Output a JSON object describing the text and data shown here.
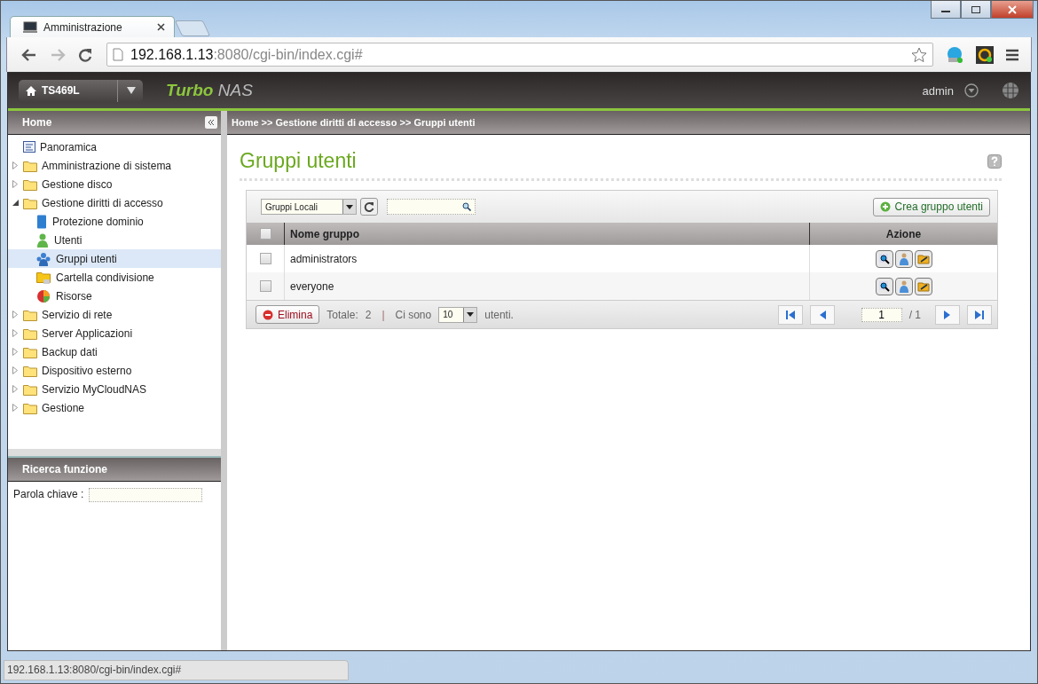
{
  "browser": {
    "tab_title": "Amministrazione",
    "address_host": "192.168.1.13",
    "address_rest": ":8080/cgi-bin/index.cgi#",
    "status_url": "192.168.1.13:8080/cgi-bin/index.cgi#"
  },
  "header": {
    "device": "TS469L",
    "brand_first": "Turbo",
    "brand_second": "NAS",
    "user": "admin"
  },
  "sidebar": {
    "title": "Home",
    "items": [
      {
        "label": "Panoramica",
        "kind": "overview",
        "selected": false
      },
      {
        "label": "Amministrazione di sistema",
        "kind": "folder",
        "expanded": false,
        "selected": false
      },
      {
        "label": "Gestione disco",
        "kind": "folder",
        "expanded": false,
        "selected": false
      },
      {
        "label": "Gestione diritti di accesso",
        "kind": "folder",
        "expanded": true,
        "selected": false,
        "children": [
          {
            "label": "Protezione dominio",
            "kind": "book",
            "selected": false
          },
          {
            "label": "Utenti",
            "kind": "user",
            "selected": false
          },
          {
            "label": "Gruppi utenti",
            "kind": "group",
            "selected": true
          },
          {
            "label": "Cartella condivisione",
            "kind": "share",
            "selected": false
          },
          {
            "label": "Risorse",
            "kind": "resources",
            "selected": false
          }
        ]
      },
      {
        "label": "Servizio di rete",
        "kind": "folder",
        "expanded": false,
        "selected": false
      },
      {
        "label": "Server Applicazioni",
        "kind": "folder",
        "expanded": false,
        "selected": false
      },
      {
        "label": "Backup dati",
        "kind": "folder",
        "expanded": false,
        "selected": false
      },
      {
        "label": "Dispositivo esterno",
        "kind": "folder",
        "expanded": false,
        "selected": false
      },
      {
        "label": "Servizio MyCloudNAS",
        "kind": "folder",
        "expanded": false,
        "selected": false
      },
      {
        "label": "Gestione",
        "kind": "folder",
        "expanded": false,
        "selected": false
      }
    ]
  },
  "search_panel": {
    "title": "Ricerca funzione",
    "label": "Parola chiave :"
  },
  "breadcrumb": "Home >> Gestione diritti di accesso >> Gruppi utenti",
  "page": {
    "title": "Gruppi utenti",
    "filter": "Gruppi Locali",
    "create_button": "Crea gruppo utenti",
    "table": {
      "columns": [
        "Nome gruppo",
        "Azione"
      ],
      "all_checked": false,
      "rows": [
        {
          "name": "administrators",
          "checked": false
        },
        {
          "name": "everyone",
          "checked": false
        }
      ]
    },
    "footer": {
      "delete_button": "Elimina",
      "total_label": "Totale:",
      "total": "2",
      "separator": "|",
      "per_page_label": "Ci sono",
      "per_page": "10",
      "per_page_unit": "utenti.",
      "page": "1",
      "pages": "/ 1"
    }
  }
}
